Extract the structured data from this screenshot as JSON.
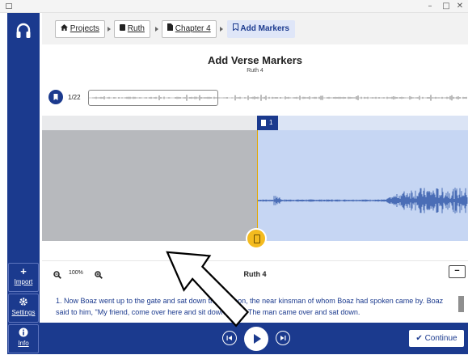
{
  "window": {
    "minimize": "–",
    "maximize": "□",
    "close": "✕"
  },
  "sidebar": {
    "brand_icon": "headphones-icon",
    "items": [
      {
        "label": "Import",
        "icon": "plus-icon",
        "glyph": "+"
      },
      {
        "label": "Settings",
        "icon": "gear-icon",
        "glyph": "✹"
      },
      {
        "label": "Info",
        "icon": "info-icon",
        "glyph": "i"
      }
    ]
  },
  "breadcrumb": {
    "items": [
      {
        "label": "Projects",
        "icon": "home-icon"
      },
      {
        "label": "Ruth",
        "icon": "book-icon"
      },
      {
        "label": "Chapter 4",
        "icon": "document-icon"
      },
      {
        "label": "Add Markers",
        "icon": "bookmark-icon"
      }
    ]
  },
  "page": {
    "title": "Add Verse Markers",
    "subtitle": "Ruth 4"
  },
  "overview": {
    "marker_count": "1/22"
  },
  "waveform": {
    "marker_label": "1",
    "played_color": "#b7b9bd",
    "unplayed_color": "#c6d6f3",
    "wave_color": "#4a6db6",
    "cursor_color": "#e4a900"
  },
  "zoom": {
    "level": "100%",
    "zoom_out_icon": "zoom-out-icon",
    "zoom_in_icon": "zoom-in-icon"
  },
  "chapter": {
    "title": "Ruth 4",
    "collapse_label": "−"
  },
  "verse_text": "1. Now Boaz went up to the gate and sat down there. Soon, the near kinsman of whom Boaz had spoken came by. Boaz said to him, \"My friend, come over here and sit down here.\" The man came over and sat down.",
  "footer": {
    "continue_label": "Continue"
  },
  "colors": {
    "brand": "#1b3a8e",
    "accent": "#f4bb1f"
  }
}
